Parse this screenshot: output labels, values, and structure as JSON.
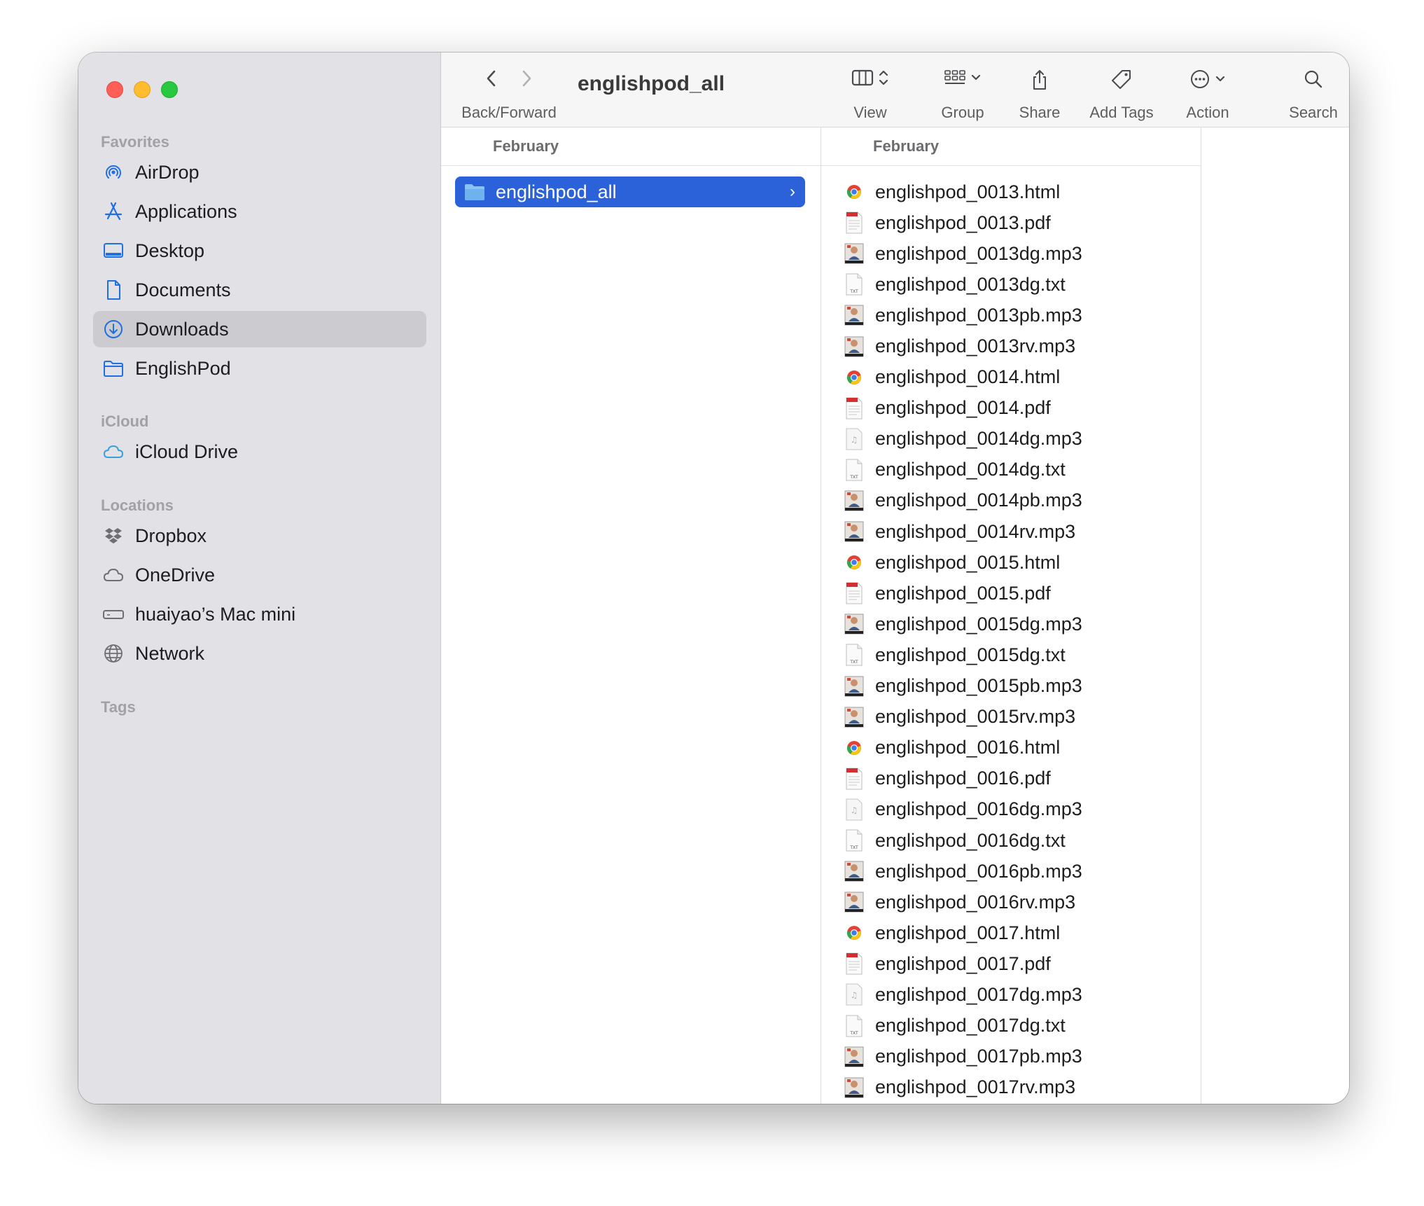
{
  "window": {
    "title": "englishpod_all"
  },
  "toolbar": {
    "back_forward_label": "Back/Forward",
    "view_label": "View",
    "group_label": "Group",
    "share_label": "Share",
    "add_tags_label": "Add Tags",
    "action_label": "Action",
    "search_label": "Search"
  },
  "sidebar": {
    "favorites_heading": "Favorites",
    "favorites": [
      {
        "label": "AirDrop",
        "icon": "airdrop-icon"
      },
      {
        "label": "Applications",
        "icon": "applications-icon"
      },
      {
        "label": "Desktop",
        "icon": "desktop-icon"
      },
      {
        "label": "Documents",
        "icon": "documents-icon"
      },
      {
        "label": "Downloads",
        "icon": "downloads-icon",
        "selected": true
      },
      {
        "label": "EnglishPod",
        "icon": "folder-icon"
      }
    ],
    "icloud_heading": "iCloud",
    "icloud": [
      {
        "label": "iCloud Drive",
        "icon": "icloud-icon"
      }
    ],
    "locations_heading": "Locations",
    "locations": [
      {
        "label": "Dropbox",
        "icon": "dropbox-icon"
      },
      {
        "label": "OneDrive",
        "icon": "cloud-icon"
      },
      {
        "label": "huaiyao’s Mac mini",
        "icon": "mac-mini-icon"
      },
      {
        "label": "Network",
        "icon": "network-icon"
      }
    ],
    "tags_heading": "Tags"
  },
  "columns": {
    "col1_header": "February",
    "col1_selected_folder": "englishpod_all",
    "col2_header": "February",
    "files": [
      {
        "name": "englishpod_0013.html",
        "type": "html"
      },
      {
        "name": "englishpod_0013.pdf",
        "type": "pdf"
      },
      {
        "name": "englishpod_0013dg.mp3",
        "type": "mp3-art"
      },
      {
        "name": "englishpod_0013dg.txt",
        "type": "txt"
      },
      {
        "name": "englishpod_0013pb.mp3",
        "type": "mp3-art"
      },
      {
        "name": "englishpod_0013rv.mp3",
        "type": "mp3-art"
      },
      {
        "name": "englishpod_0014.html",
        "type": "html"
      },
      {
        "name": "englishpod_0014.pdf",
        "type": "pdf"
      },
      {
        "name": "englishpod_0014dg.mp3",
        "type": "mp3-plain"
      },
      {
        "name": "englishpod_0014dg.txt",
        "type": "txt"
      },
      {
        "name": "englishpod_0014pb.mp3",
        "type": "mp3-art"
      },
      {
        "name": "englishpod_0014rv.mp3",
        "type": "mp3-art"
      },
      {
        "name": "englishpod_0015.html",
        "type": "html"
      },
      {
        "name": "englishpod_0015.pdf",
        "type": "pdf"
      },
      {
        "name": "englishpod_0015dg.mp3",
        "type": "mp3-art"
      },
      {
        "name": "englishpod_0015dg.txt",
        "type": "txt"
      },
      {
        "name": "englishpod_0015pb.mp3",
        "type": "mp3-art"
      },
      {
        "name": "englishpod_0015rv.mp3",
        "type": "mp3-art"
      },
      {
        "name": "englishpod_0016.html",
        "type": "html"
      },
      {
        "name": "englishpod_0016.pdf",
        "type": "pdf"
      },
      {
        "name": "englishpod_0016dg.mp3",
        "type": "mp3-plain"
      },
      {
        "name": "englishpod_0016dg.txt",
        "type": "txt"
      },
      {
        "name": "englishpod_0016pb.mp3",
        "type": "mp3-art"
      },
      {
        "name": "englishpod_0016rv.mp3",
        "type": "mp3-art"
      },
      {
        "name": "englishpod_0017.html",
        "type": "html"
      },
      {
        "name": "englishpod_0017.pdf",
        "type": "pdf"
      },
      {
        "name": "englishpod_0017dg.mp3",
        "type": "mp3-plain"
      },
      {
        "name": "englishpod_0017dg.txt",
        "type": "txt"
      },
      {
        "name": "englishpod_0017pb.mp3",
        "type": "mp3-art"
      },
      {
        "name": "englishpod_0017rv.mp3",
        "type": "mp3-art"
      }
    ]
  },
  "colors": {
    "accent_blue": "#2b62d9",
    "sidebar_icon_blue": "#1f6fe5",
    "close": "#ff5f57",
    "minimize": "#febc2e",
    "zoom": "#28c840"
  }
}
